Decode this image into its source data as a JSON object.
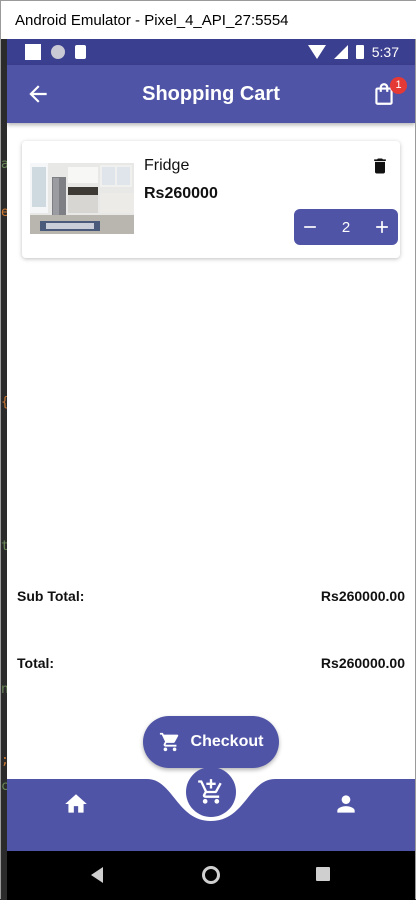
{
  "window": {
    "title": "Android Emulator - Pixel_4_API_27:5554"
  },
  "status_bar": {
    "time": "5:37"
  },
  "app_bar": {
    "title": "Shopping Cart",
    "cart_badge": "1",
    "back_icon": "arrow-back-icon",
    "cart_icon": "shopping-bag-icon"
  },
  "cart": {
    "items": [
      {
        "name": "Fridge",
        "price": "Rs260000",
        "quantity": "2",
        "image": "kitchen-photo"
      }
    ]
  },
  "summary": {
    "subtotal_label": "Sub Total:",
    "subtotal_value": "Rs260000.00",
    "total_label": "Total:",
    "total_value": "Rs260000.00"
  },
  "checkout": {
    "label": "Checkout",
    "icon": "cart-icon"
  },
  "bottom_nav": {
    "home_icon": "home-icon",
    "center_icon": "add-to-cart-icon",
    "profile_icon": "person-icon"
  },
  "colors": {
    "primary": "#4f54a6",
    "status_bar": "#3b3f8f",
    "badge": "#e53935"
  },
  "gutter_chars": [
    "a",
    "e",
    "{",
    "t",
    "n",
    ";",
    "c"
  ]
}
